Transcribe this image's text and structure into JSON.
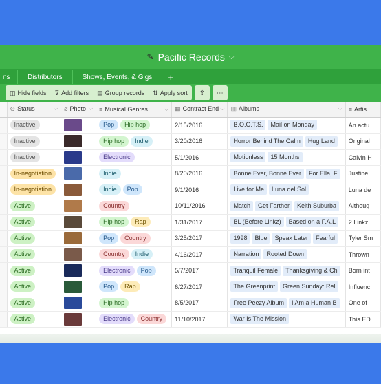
{
  "app": {
    "title": "Pacific Records",
    "logo_icon": "pencil-icon",
    "brand_color": "#3fb34a",
    "background_color": "#3b79ea"
  },
  "tabs": [
    {
      "label": "ns"
    },
    {
      "label": "Distributors"
    },
    {
      "label": "Shows, Events, & Gigs"
    },
    {
      "label": "+"
    }
  ],
  "toolbar": {
    "hide_fields": "Hide fields",
    "add_filters": "Add filters",
    "group_records": "Group records",
    "apply_sort": "Apply sort",
    "share_icon": "share-icon",
    "more_icon": "more-icon"
  },
  "columns": {
    "status": "Status",
    "photo": "Photo",
    "genres": "Musical Genres",
    "contract_end": "Contract End",
    "albums": "Albums",
    "artist": "Artis"
  },
  "rows": [
    {
      "status": "Inactive",
      "status_kind": "inactive",
      "photo_color": "#6a4a8a",
      "genres": [
        {
          "label": "Pop",
          "kind": "pop"
        },
        {
          "label": "Hip hop",
          "kind": "hiphop"
        }
      ],
      "contract_end": "2/15/2016",
      "albums": [
        "B.O.O.T.S.",
        "Mail on Monday"
      ],
      "artist": "An actu"
    },
    {
      "status": "Inactive",
      "status_kind": "inactive",
      "photo_color": "#3a2a2a",
      "genres": [
        {
          "label": "Hip hop",
          "kind": "hiphop"
        },
        {
          "label": "Indie",
          "kind": "indie"
        }
      ],
      "contract_end": "3/20/2016",
      "albums": [
        "Horror Behind The Calm",
        "Hug Land"
      ],
      "artist": "Original"
    },
    {
      "status": "Inactive",
      "status_kind": "inactive",
      "photo_color": "#2a3a8a",
      "genres": [
        {
          "label": "Electronic",
          "kind": "electronic"
        }
      ],
      "contract_end": "5/1/2016",
      "albums": [
        "Motionless",
        "15 Months"
      ],
      "artist": "Calvin H"
    },
    {
      "status": "In-negotiation",
      "status_kind": "neg",
      "photo_color": "#4a6aaa",
      "genres": [
        {
          "label": "Indie",
          "kind": "indie"
        }
      ],
      "contract_end": "8/20/2016",
      "albums": [
        "Bonne Ever, Bonne Ever",
        "For Ella, F"
      ],
      "artist": "Justine"
    },
    {
      "status": "In-negotiation",
      "status_kind": "neg",
      "photo_color": "#8a5a3a",
      "genres": [
        {
          "label": "Indie",
          "kind": "indie"
        },
        {
          "label": "Pop",
          "kind": "pop"
        }
      ],
      "contract_end": "9/1/2016",
      "albums": [
        "Live for Me",
        "Luna del Sol"
      ],
      "artist": "Luna de"
    },
    {
      "status": "Active",
      "status_kind": "active",
      "photo_color": "#b07a4a",
      "genres": [
        {
          "label": "Country",
          "kind": "country"
        }
      ],
      "contract_end": "10/11/2016",
      "albums": [
        "Match",
        "Get Farther",
        "Keith Suburba"
      ],
      "artist": "Althoug"
    },
    {
      "status": "Active",
      "status_kind": "active",
      "photo_color": "#5a4a3a",
      "genres": [
        {
          "label": "Hip hop",
          "kind": "hiphop"
        },
        {
          "label": "Rap",
          "kind": "rap"
        }
      ],
      "contract_end": "1/31/2017",
      "albums": [
        "BL (Before Linkz)",
        "Based on a F.A.L"
      ],
      "artist": "2 Linkz"
    },
    {
      "status": "Active",
      "status_kind": "active",
      "photo_color": "#9a6a3a",
      "genres": [
        {
          "label": "Pop",
          "kind": "pop"
        },
        {
          "label": "Country",
          "kind": "country"
        }
      ],
      "contract_end": "3/25/2017",
      "albums": [
        "1998",
        "Blue",
        "Speak Later",
        "Fearful"
      ],
      "artist": "Tyler Sm"
    },
    {
      "status": "Active",
      "status_kind": "active",
      "photo_color": "#7a5a4a",
      "genres": [
        {
          "label": "Country",
          "kind": "country"
        },
        {
          "label": "Indie",
          "kind": "indie"
        }
      ],
      "contract_end": "4/16/2017",
      "albums": [
        "Narration",
        "Rooted Down"
      ],
      "artist": "Thrown"
    },
    {
      "status": "Active",
      "status_kind": "active",
      "photo_color": "#1a2a5a",
      "genres": [
        {
          "label": "Electronic",
          "kind": "electronic"
        },
        {
          "label": "Pop",
          "kind": "pop"
        }
      ],
      "contract_end": "5/7/2017",
      "albums": [
        "Tranquil Female",
        "Thanksgiving & Ch"
      ],
      "artist": "Born int"
    },
    {
      "status": "Active",
      "status_kind": "active",
      "photo_color": "#2a5a3a",
      "genres": [
        {
          "label": "Pop",
          "kind": "pop"
        },
        {
          "label": "Rap",
          "kind": "rap"
        }
      ],
      "contract_end": "6/27/2017",
      "albums": [
        "The Greenprint",
        "Green Sunday: Rel"
      ],
      "artist": "Influenc"
    },
    {
      "status": "Active",
      "status_kind": "active",
      "photo_color": "#2a4a9a",
      "genres": [
        {
          "label": "Hip hop",
          "kind": "hiphop"
        }
      ],
      "contract_end": "8/5/2017",
      "albums": [
        "Free Peezy Album",
        "I Am a Human B"
      ],
      "artist": "One of"
    },
    {
      "status": "Active",
      "status_kind": "active",
      "photo_color": "#6a3a3a",
      "genres": [
        {
          "label": "Electronic",
          "kind": "electronic"
        },
        {
          "label": "Country",
          "kind": "country"
        }
      ],
      "contract_end": "11/10/2017",
      "albums": [
        "War Is The Mission"
      ],
      "artist": "This ED"
    }
  ]
}
